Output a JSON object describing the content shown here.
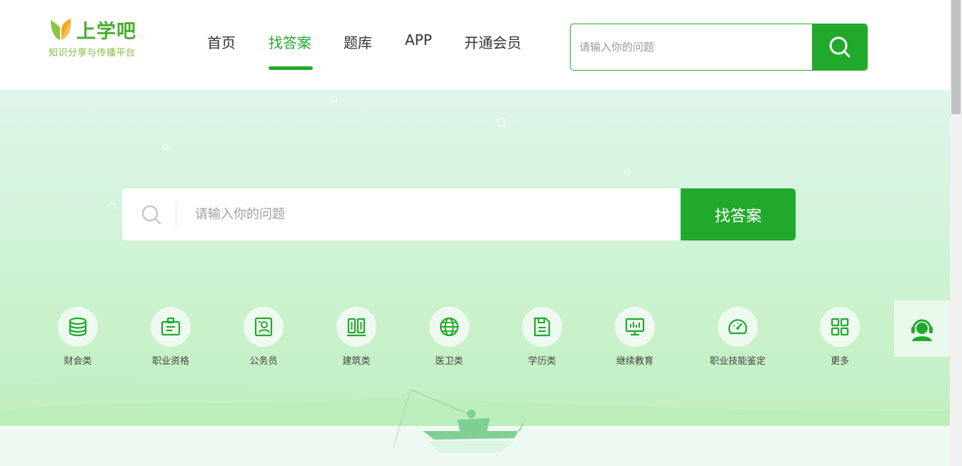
{
  "logo": {
    "title": "上学吧",
    "subtitle": "知识分享与传播平台"
  },
  "nav": {
    "items": [
      {
        "label": "首页",
        "active": false
      },
      {
        "label": "找答案",
        "active": true
      },
      {
        "label": "题库",
        "active": false
      },
      {
        "label": "APP",
        "active": false
      },
      {
        "label": "开通会员",
        "active": false
      }
    ]
  },
  "top_search": {
    "placeholder": "请输入你的问题",
    "icon": "search-icon"
  },
  "main_search": {
    "placeholder": "请输入你的问题",
    "button_label": "找答案",
    "icon": "search-icon"
  },
  "categories": [
    {
      "label": "财会类",
      "icon": "database-coins-icon"
    },
    {
      "label": "职业资格",
      "icon": "id-badge-icon"
    },
    {
      "label": "公务员",
      "icon": "portrait-card-icon"
    },
    {
      "label": "建筑类",
      "icon": "building-columns-icon"
    },
    {
      "label": "医卫类",
      "icon": "globe-icon"
    },
    {
      "label": "学历类",
      "icon": "document-icon"
    },
    {
      "label": "继续教育",
      "icon": "monitor-chart-icon"
    },
    {
      "label": "职业技能鉴定",
      "icon": "gauge-icon"
    },
    {
      "label": "更多",
      "icon": "grid-icon"
    }
  ],
  "service": {
    "icon": "customer-service-icon"
  },
  "colors": {
    "accent": "#21a92c",
    "hero_bg": "#d4f4dd",
    "text": "#333333"
  }
}
